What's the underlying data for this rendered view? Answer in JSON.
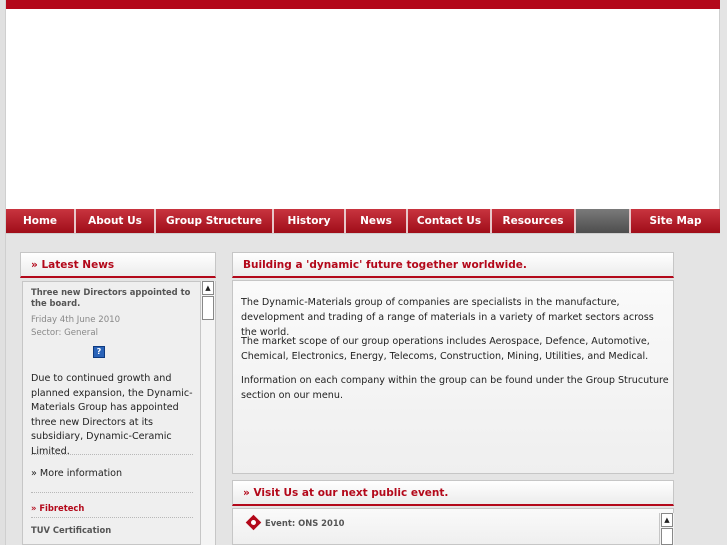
{
  "nav": {
    "items": [
      {
        "label": "Home"
      },
      {
        "label": "About Us"
      },
      {
        "label": "Group Structure"
      },
      {
        "label": "History"
      },
      {
        "label": "News"
      },
      {
        "label": "Contact Us"
      },
      {
        "label": "Resources"
      },
      {
        "label": ""
      },
      {
        "label": "Site Map"
      }
    ]
  },
  "latest_news": {
    "title": "» Latest News",
    "item": {
      "headline": "Three new Directors appointed to the board.",
      "date": "Friday 4th June 2010",
      "sector": "Sector: General",
      "body": "Due to continued growth and planned expansion, the Dynamic-Materials Group has appointed three new Directors at its subsidiary, Dynamic-Ceramic Limited.",
      "more": "» More information"
    },
    "next_company": "» Fibretech",
    "next_headline": "TUV Certification"
  },
  "main": {
    "title": "Building a 'dynamic' future together worldwide.",
    "paragraphs": [
      "The Dynamic-Materials group of companies are specialists in the manufacture, development and trading of a range of materials in a variety of market sectors across the world.",
      "The market scope of our group operations includes Aerospace, Defence, Automotive, Chemical, Electronics, Energy, Telecoms, Construction, Mining, Utilities, and Medical.",
      "Information on each company within the group can be found under the Group Strucuture section on our menu."
    ]
  },
  "events": {
    "title": "» Visit Us at our next public event.",
    "item": "Event: ONS 2010"
  },
  "colors": {
    "brand_red": "#b3081a",
    "background": "#e4e4e4"
  }
}
